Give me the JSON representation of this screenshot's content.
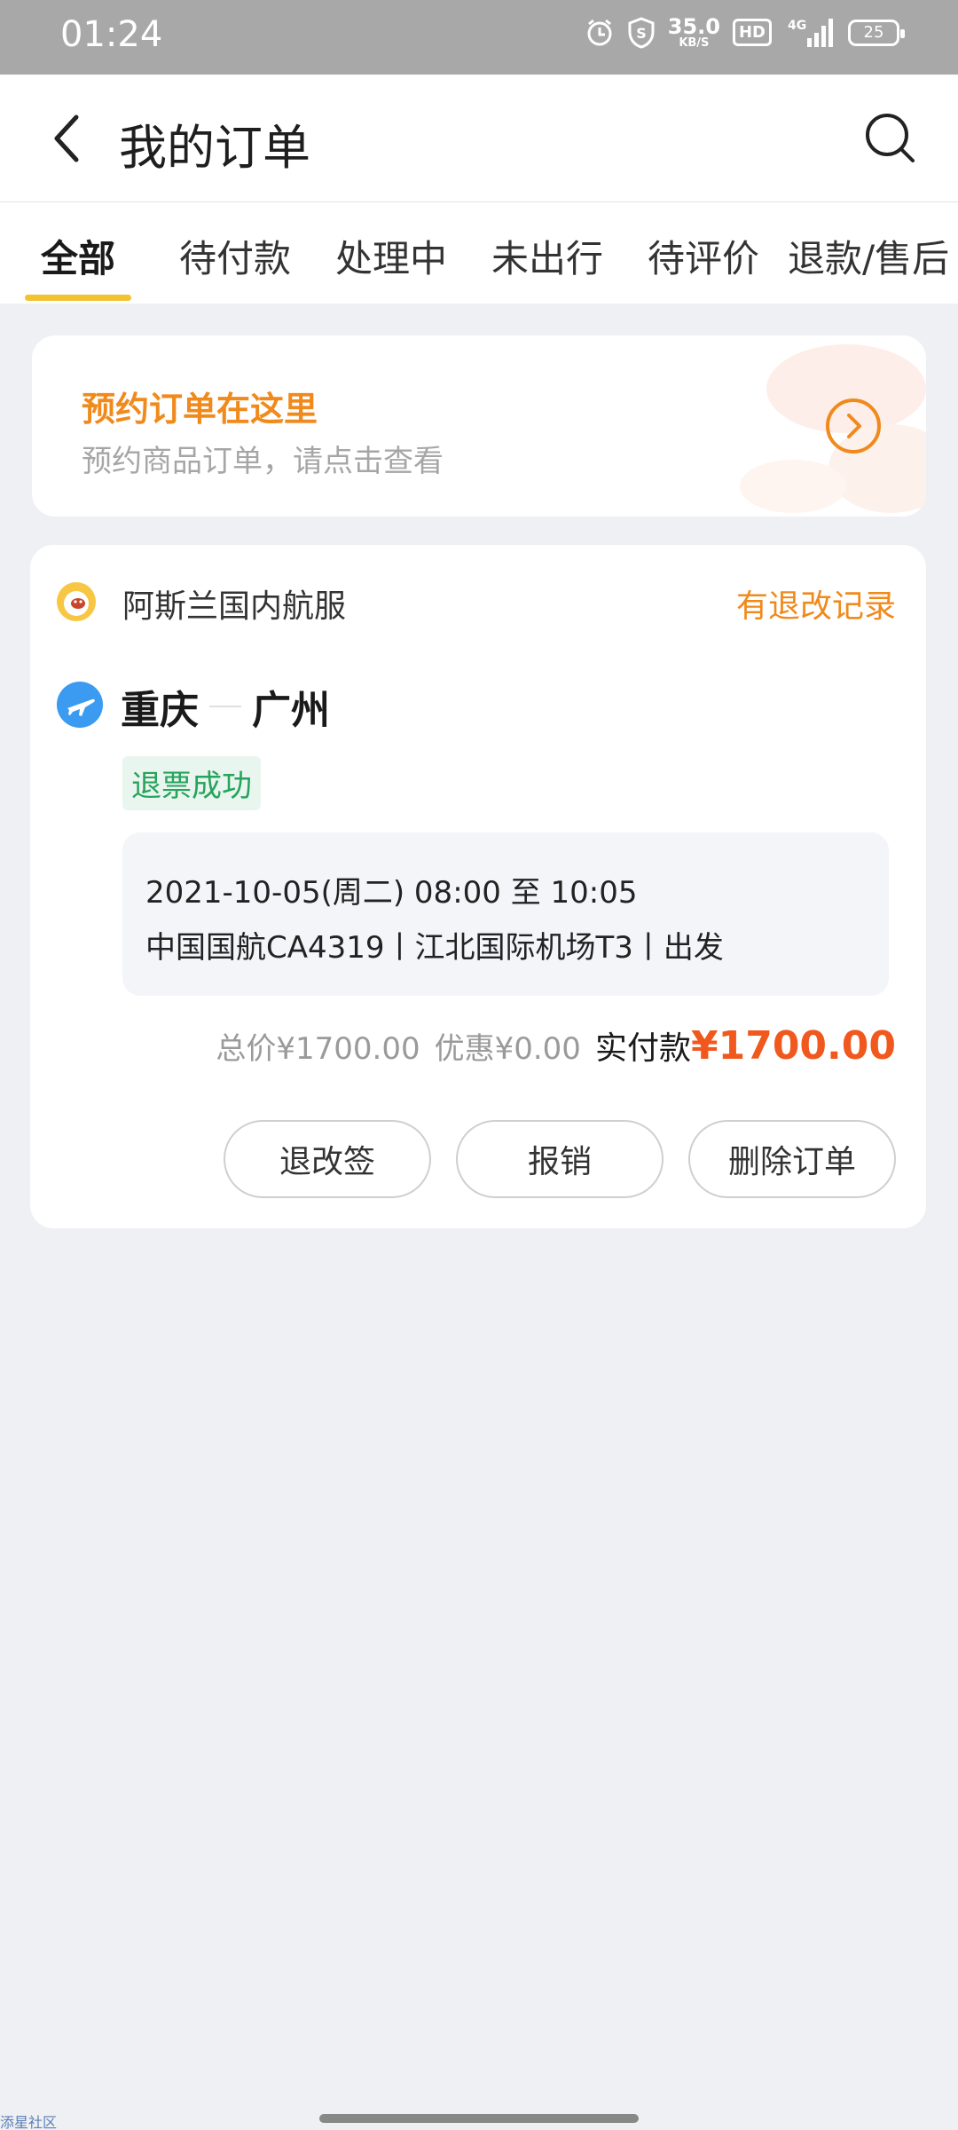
{
  "status_bar": {
    "time": "01:24",
    "net_speed": "35.0",
    "net_speed_unit": "KB/S",
    "hd": "HD",
    "network": "4G",
    "battery": "25"
  },
  "header": {
    "title": "我的订单"
  },
  "tabs": [
    {
      "label": "全部",
      "active": true
    },
    {
      "label": "待付款",
      "active": false
    },
    {
      "label": "处理中",
      "active": false
    },
    {
      "label": "未出行",
      "active": false
    },
    {
      "label": "待评价",
      "active": false
    },
    {
      "label": "退款/售后",
      "active": false
    }
  ],
  "promo": {
    "title": "预约订单在这里",
    "subtitle": "预约商品订单，请点击查看"
  },
  "order": {
    "merchant": "阿斯兰国内航服",
    "change_record": "有退改记录",
    "from_city": "重庆",
    "to_city": "广州",
    "status": "退票成功",
    "flight_time": "2021-10-05(周二) 08:00 至 10:05",
    "flight_detail": "中国国航CA4319丨江北国际机场T3丨出发",
    "total_price": "总价¥1700.00",
    "discount": "优惠¥0.00",
    "paid_label": "实付款",
    "paid_amount": "¥1700.00",
    "actions": [
      "退改签",
      "报销",
      "删除订单"
    ]
  },
  "watermark": "添星社区",
  "colors": {
    "accent_yellow": "#f2c230",
    "orange": "#f08a1c",
    "price_red": "#f0581e",
    "success_green": "#27a35c"
  }
}
